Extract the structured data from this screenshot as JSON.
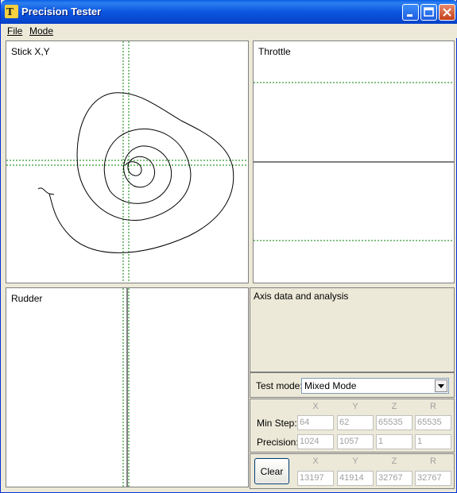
{
  "window": {
    "title": "Precision Tester"
  },
  "menu": {
    "file": "File",
    "mode": "Mode"
  },
  "panels": {
    "stick": {
      "label": "Stick X,Y"
    },
    "throttle": {
      "label": "Throttle"
    },
    "rudder": {
      "label": "Rudder"
    },
    "analysis": {
      "label": "Axis data and analysis"
    }
  },
  "test_mode": {
    "label": "Test mode:",
    "value": "Mixed Mode"
  },
  "table": {
    "columns": [
      "X",
      "Y",
      "Z",
      "R"
    ],
    "min_step": {
      "label": "Min Step:",
      "values": [
        "64",
        "62",
        "65535",
        "65535"
      ]
    },
    "precision": {
      "label": "Precision:",
      "values": [
        "1024",
        "1057",
        "1",
        "1"
      ]
    },
    "current": {
      "values": [
        "13197",
        "41914",
        "32767",
        "32767"
      ]
    }
  },
  "clear_button": {
    "label": "Clear"
  },
  "colors": {
    "crosshair": "#008000",
    "trace": "#000000",
    "titlebar": "#0a56e0"
  }
}
